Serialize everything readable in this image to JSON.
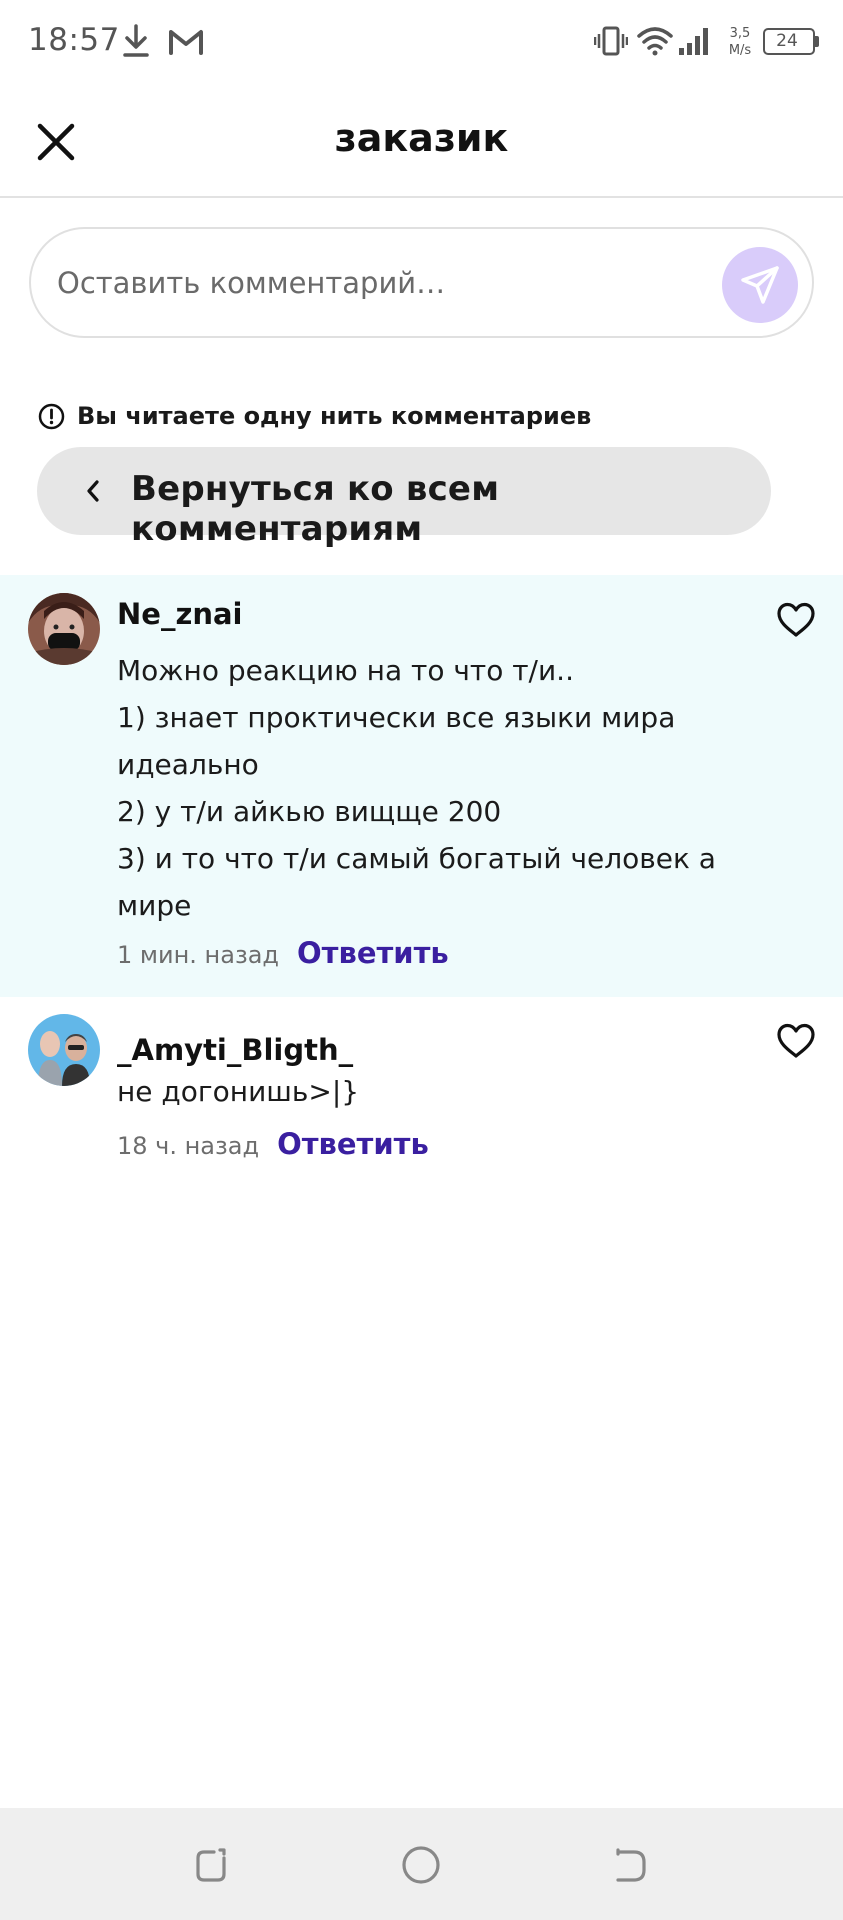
{
  "status_bar": {
    "time": "18:57",
    "icons": [
      "download-icon",
      "gmail-icon",
      "vibrate-icon",
      "wifi-icon",
      "signal-icon"
    ],
    "speed_value": "3,5",
    "speed_unit": "M/s",
    "battery": "24"
  },
  "header": {
    "title": "заказик",
    "close_icon": "close-icon"
  },
  "comment_input": {
    "placeholder": "Оставить комментарий…",
    "send_icon": "send-icon",
    "send_button_color": "#d9ccfa"
  },
  "thread": {
    "notice": "Вы читаете одну нить комментариев",
    "notice_icon": "info-icon",
    "back_label": "Вернуться ко всем комментариям",
    "back_icon": "chevron-left-icon"
  },
  "comments": [
    {
      "username": "Ne_znai",
      "text": "Можно реакцию на то что т/и..\n1) знает проктически все языки мира идеально\n2) у т/и айкью вищще 200\n3) и то что т/и самый богатый человек а мире",
      "time": "1 мин. назад",
      "reply": "Ответить",
      "highlighted": true,
      "like_icon": "heart-icon"
    },
    {
      "username": "_Amyti_Bligth_",
      "text": "не догонишь>|}",
      "time": "18 ч. назад",
      "reply": "Ответить",
      "highlighted": false,
      "like_icon": "heart-icon"
    }
  ],
  "nav_bar": {
    "buttons": [
      "recents-icon",
      "home-icon",
      "back-icon"
    ]
  },
  "colors": {
    "accent": "#3a1fa0",
    "highlight_bg": "#effbfc",
    "back_button_bg": "#e6e6e6"
  }
}
